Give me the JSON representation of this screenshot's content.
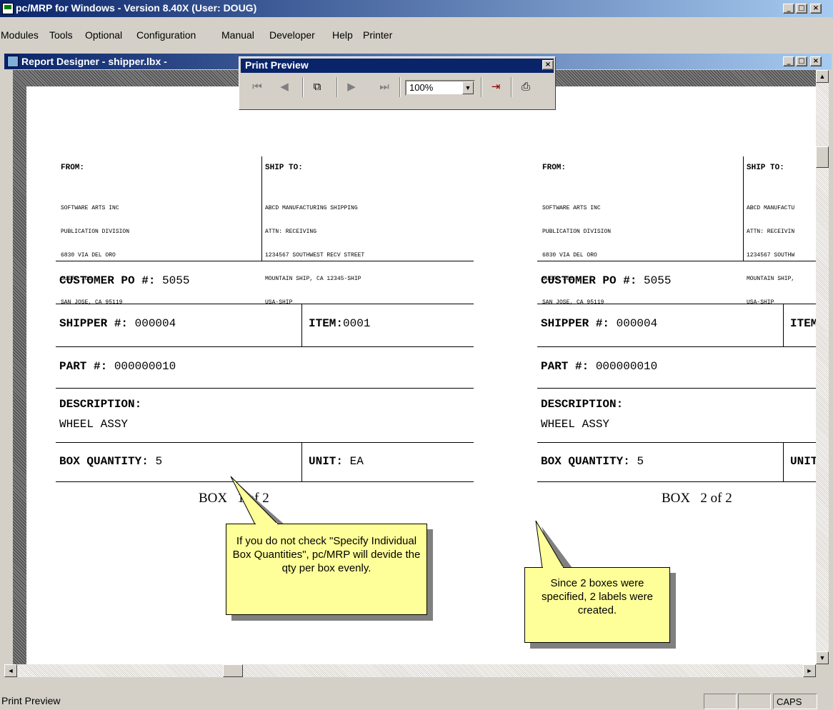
{
  "window": {
    "title": "pc/MRP for Windows - Version 8.40X  (User: DOUG)"
  },
  "menu": [
    "Modules",
    "Tools",
    "Optional",
    "Configuration",
    "Manual",
    "Developer",
    "Help",
    "Printer"
  ],
  "child": {
    "title": "Report Designer - shipper.lbx -"
  },
  "preview_toolbar": {
    "title": "Print Preview",
    "zoom": "100%"
  },
  "labels": [
    {
      "from_header": "FROM:",
      "from_lines": [
        "SOFTWARE ARTS INC",
        "PUBLICATION DIVISION",
        "6830 VIA DEL ORO",
        "SUITE 101",
        "SAN JOSE, CA 95119"
      ],
      "shipto_header": "SHIP TO:",
      "shipto_lines": [
        "ABCD MANUFACTURING SHIPPING",
        "ATTN: RECEIVING",
        "1234567 SOUTHWEST RECV STREET",
        "MOUNTAIN SHIP, CA 12345-SHIP",
        "USA-SHIP"
      ],
      "po_label": "CUSTOMER PO #:",
      "po_value": "5055",
      "shipper_label": "SHIPPER #:",
      "shipper_value": "000004",
      "item_label": "ITEM:",
      "item_value": "0001",
      "part_label": "PART #:",
      "part_value": "000000010",
      "desc_label": "DESCRIPTION:",
      "desc_value": "WHEEL ASSY",
      "qty_label": "BOX QUANTITY:",
      "qty_value": "5",
      "unit_label": "UNIT:",
      "unit_value": "EA",
      "box_text": "BOX",
      "box_count": "1 of 2"
    },
    {
      "from_header": "FROM:",
      "from_lines": [
        "SOFTWARE ARTS INC",
        "PUBLICATION DIVISION",
        "6830 VIA DEL ORO",
        "SUITE 101",
        "SAN JOSE, CA 95119"
      ],
      "shipto_header": "SHIP TO:",
      "shipto_lines": [
        "ABCD MANUFACTU",
        "ATTN: RECEIVIN",
        "1234567 SOUTHW",
        "MOUNTAIN SHIP,",
        "USA-SHIP"
      ],
      "po_label": "CUSTOMER PO #:",
      "po_value": "5055",
      "shipper_label": "SHIPPER #:",
      "shipper_value": "000004",
      "item_label": "ITEM",
      "item_value": "",
      "part_label": "PART #:",
      "part_value": "000000010",
      "desc_label": "DESCRIPTION:",
      "desc_value": "WHEEL ASSY",
      "qty_label": "BOX QUANTITY:",
      "qty_value": "5",
      "unit_label": "UNIT",
      "unit_value": "",
      "box_text": "BOX",
      "box_count": "2 of 2"
    }
  ],
  "callouts": [
    "If you do not check \"Specify Individual Box Quantities\", pc/MRP will devide the qty per box evenly.",
    "Since 2 boxes were specified, 2 labels were created."
  ],
  "status": {
    "text": "Print Preview",
    "caps": "CAPS"
  }
}
